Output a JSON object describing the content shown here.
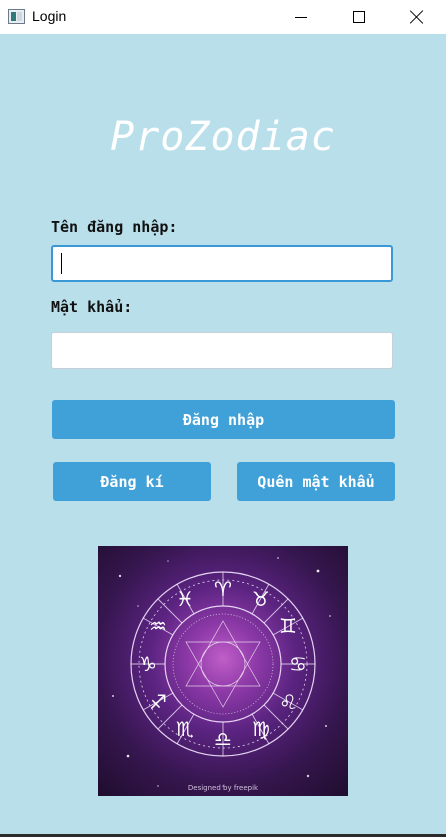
{
  "window": {
    "title": "Login"
  },
  "app": {
    "title": "ProZodiac"
  },
  "form": {
    "username_label": "Tên đăng nhập:",
    "username_value": "",
    "password_label": "Mật khẩu:",
    "password_value": ""
  },
  "buttons": {
    "login": "Đăng nhập",
    "register": "Đăng kí",
    "forgot": "Quên mật khẩu"
  },
  "image": {
    "credit": "Designed by freepik"
  },
  "icons": {
    "app": "window-app-icon",
    "minimize": "minimize-icon",
    "maximize": "maximize-icon",
    "close": "close-icon"
  },
  "colors": {
    "background": "#b9dfeb",
    "button": "#40a0d8",
    "input_focus_border": "#3b98d6"
  }
}
